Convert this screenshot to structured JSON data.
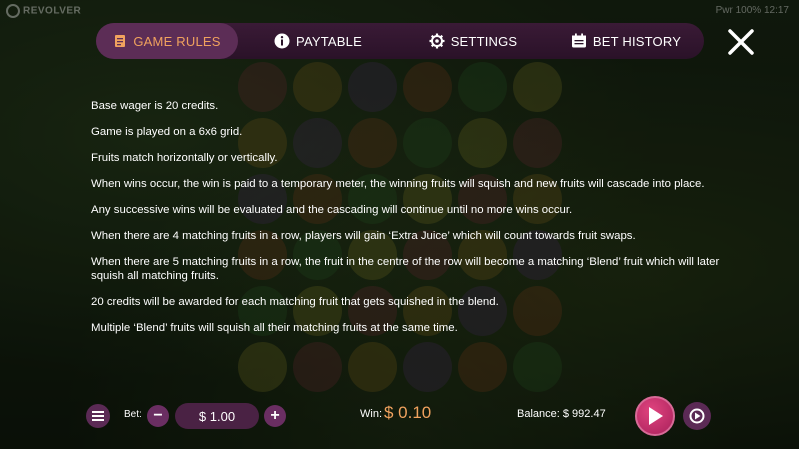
{
  "header": {
    "brand": "REVOLVER",
    "status": "Pwr 100%   12:17"
  },
  "nav": {
    "tabs": [
      {
        "label": "GAME RULES",
        "icon": "book-icon",
        "active": true
      },
      {
        "label": "PAYTABLE",
        "icon": "info-icon",
        "active": false
      },
      {
        "label": "SETTINGS",
        "icon": "gear-icon",
        "active": false
      },
      {
        "label": "BET HISTORY",
        "icon": "calendar-icon",
        "active": false
      }
    ],
    "close_icon": "close-icon"
  },
  "rules": [
    "Base wager is 20 credits.",
    "Game is played on a 6x6 grid.",
    "Fruits match horizontally or vertically.",
    "When wins occur, the win is paid to a temporary meter, the winning fruits will squish and new fruits will cascade into place.",
    "Any successive wins will be evaluated and the cascading will continue until no more wins occur.",
    "When there are 4 matching fruits in a row, players will gain ‘Extra Juice’ which will count towards fruit swaps.",
    "When there are 5 matching fruits in a row, the fruit in the centre of the row will become a matching ‘Blend’ fruit which will later squish all matching fruits.",
    "20 credits will be awarded for each matching fruit that gets squished in the blend.",
    "Multiple ‘Blend’ fruits will squish all their matching fruits at the same time."
  ],
  "footer": {
    "bet_label": "Bet:",
    "bet_value": "$ 1.00",
    "minus": "−",
    "plus": "+",
    "win_label": "Win:",
    "win_value": "$ 0.10",
    "balance": "Balance: $ 992.47"
  },
  "colors": {
    "accent": "#f0a25e",
    "nav_bg": "#2a1228",
    "active_tab": "#5c2d56",
    "spin": "#c22d6b"
  }
}
